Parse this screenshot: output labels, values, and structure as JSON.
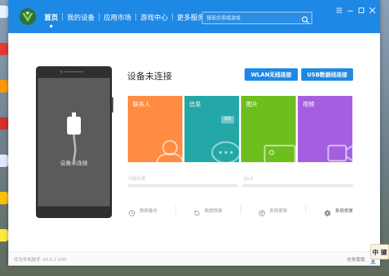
{
  "app": {
    "nav": [
      {
        "label": "首页",
        "active": true
      },
      {
        "label": "我的设备"
      },
      {
        "label": "应用市场"
      },
      {
        "label": "游戏中心"
      },
      {
        "label": "更多服务"
      }
    ],
    "search_placeholder": "搜索应用或游戏",
    "window_controls": [
      "menu-icon",
      "minimize-icon",
      "maximize-icon",
      "close-icon"
    ]
  },
  "device": {
    "phone_label": "设备未连接",
    "status_title": "设备未连接",
    "wlan_button": "WLAN无线连接",
    "usb_button": "USB数据线连接"
  },
  "tiles": [
    {
      "label": "联系人",
      "color": "#ff8c42",
      "icon": "contact-icon"
    },
    {
      "label": "信息",
      "color": "#23a7a7",
      "icon": "message-icon",
      "badge": "消息"
    },
    {
      "label": "图片",
      "color": "#6cbf1c",
      "icon": "photo-icon"
    },
    {
      "label": "视频",
      "color": "#a45ee0",
      "icon": "video-icon"
    }
  ],
  "storage": {
    "internal_label": "内部存储",
    "sd_label": "SD卡"
  },
  "actions": [
    {
      "label": "数据备份",
      "icon": "backup-icon"
    },
    {
      "label": "数据恢复",
      "icon": "restore-icon"
    },
    {
      "label": "系统更新",
      "icon": "update-icon"
    },
    {
      "label": "系统修复",
      "icon": "repair-icon"
    }
  ],
  "footer": {
    "version": "华为手机助手 10.0.1.100",
    "task_manager": "任务管理"
  },
  "ime": {
    "label": "中 键"
  },
  "colors": {
    "header": "#1e88e5",
    "accent": "#1e88e5"
  }
}
